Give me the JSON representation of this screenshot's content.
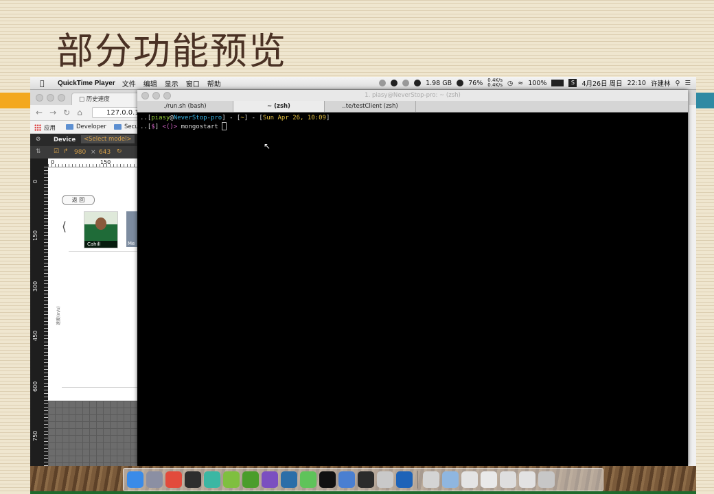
{
  "slide": {
    "title": "部分功能预览"
  },
  "menubar": {
    "app_name": "QuickTime Player",
    "items": [
      "文件",
      "编辑",
      "显示",
      "窗口",
      "帮助"
    ],
    "status": {
      "memory": "1.98 GB",
      "cpu": "76%",
      "net_up": "0.4K/s",
      "net_down": "0.4K/s",
      "battery": "100%",
      "date": "4月26日 周日",
      "time": "22:10",
      "user": "许建林"
    }
  },
  "chrome": {
    "tab_title": "历史速度",
    "url": "127.0.0.1",
    "bookmarks": [
      "应用",
      "Developer",
      "Secu"
    ]
  },
  "devtools": {
    "device_label": "Device",
    "select_model": "<Select model>",
    "width": "980",
    "times": "×",
    "height": "643",
    "ruler_top": [
      "0",
      "150"
    ],
    "ruler_left": [
      "0",
      "150",
      "300",
      "450",
      "600",
      "750"
    ]
  },
  "device_page": {
    "back_label": "返 回",
    "person_name": "Cahill",
    "person2_label": "Me",
    "y_axis_label": "速度(m/s)"
  },
  "terminal": {
    "window_title": "1. piasy@NeverStop-pro: ~ (zsh)",
    "tabs": [
      {
        "label": "./run.sh (bash)",
        "active": false
      },
      {
        "label": "~ (zsh)",
        "active": true
      },
      {
        "label": "..te/testClient (zsh)",
        "active": false
      }
    ],
    "line1": {
      "prefix": "..[",
      "user": "piasy",
      "at": "@",
      "host": "NeverStop-pro",
      "mid": "] - [",
      "dir": "~",
      "sep": "] - [",
      "date": "Sun Apr 26, 10:09",
      "end": "]"
    },
    "line2": {
      "prefix": "..[",
      "sym": "$",
      "close": "] ",
      "git": "<()>",
      "command": " mongostart "
    }
  },
  "dock": {
    "icons": [
      "finder-icon",
      "launchpad-icon",
      "chrome-icon",
      "terminal-icon",
      "atom-icon",
      "android-studio-icon",
      "evernote-icon",
      "dash-icon",
      "sourcetree-icon",
      "wechat-icon",
      "qq-icon",
      "preview-icon",
      "activity-monitor-icon",
      "script-editor-icon",
      "quicktime-icon",
      "photo-icon",
      "folder-icon",
      "doc-icon",
      "doc-icon-2",
      "doc-icon-3",
      "doc-icon-4",
      "trash-icon"
    ],
    "colors": [
      "#3a8be8",
      "#8b8fa3",
      "#e24b3c",
      "#2d2d2d",
      "#3bb7a3",
      "#7fbf3f",
      "#4a9d2b",
      "#7b4fc0",
      "#2b6ea8",
      "#5fc35a",
      "#111111",
      "#4a7fd1",
      "#2b2b2b",
      "#c9c9c9",
      "#1e63b8",
      "#d4d4d4",
      "#8fb6e0",
      "#e4e4e4",
      "#e9e9e9",
      "#dedede",
      "#e2e2e2",
      "#c7c7c7"
    ]
  }
}
